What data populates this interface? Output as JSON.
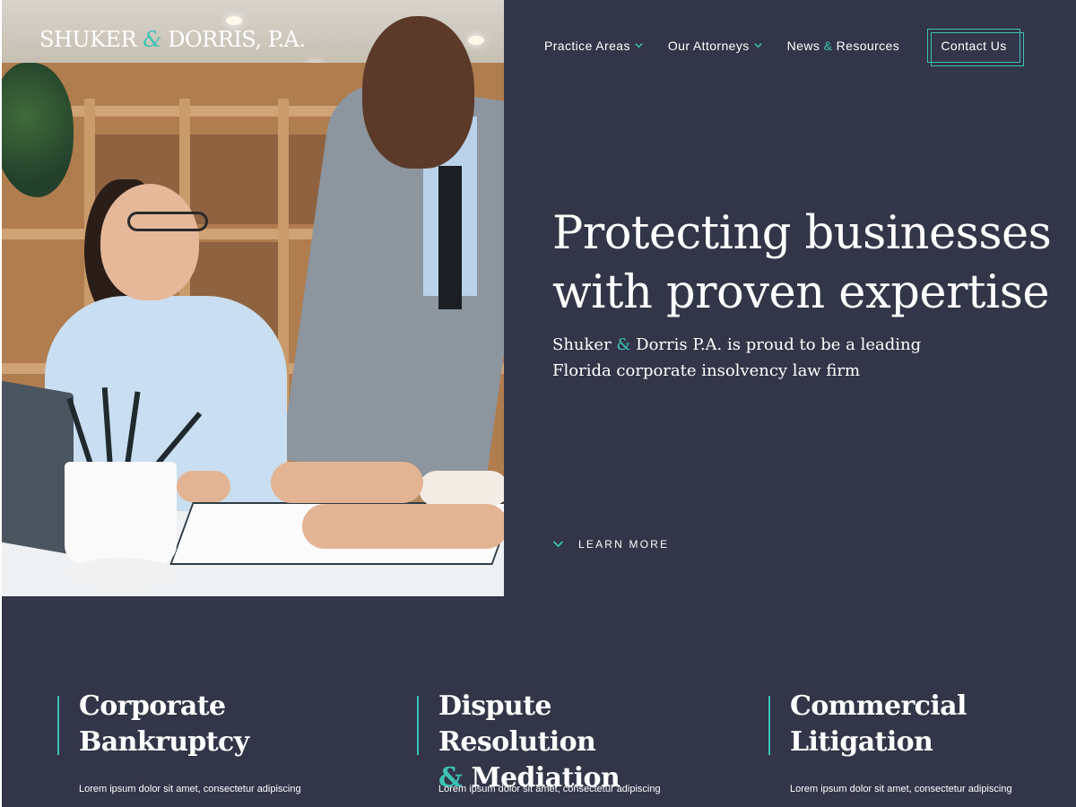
{
  "brand": {
    "logo_part1": "SHUKER ",
    "logo_amp": "&",
    "logo_part2": " DORRIS, P.A.",
    "accent_color": "#3cc2b2",
    "background_color": "#333548"
  },
  "nav": {
    "items": [
      {
        "label": "Practice Areas",
        "has_dropdown": true
      },
      {
        "label": "Our Attorneys",
        "has_dropdown": true
      },
      {
        "label_a": "News ",
        "label_amp": "&",
        "label_b": " Resources",
        "has_dropdown": false
      }
    ],
    "contact_label": "Contact Us"
  },
  "hero": {
    "headline_line1": "Protecting businesses",
    "headline_line2": "with proven expertise",
    "subhead_a": "Shuker ",
    "subhead_amp": "&",
    "subhead_b": " Dorris P.A. is proud to be a leading",
    "subhead_line2": "Florida corporate insolvency law firm",
    "learn_more": "LEARN MORE",
    "photo_icon": "office-meeting-photo"
  },
  "services": [
    {
      "title_line1": "Corporate",
      "title_line2": "Bankruptcy",
      "description": "Lorem ipsum dolor sit amet, consectetur adipiscing"
    },
    {
      "title_line1": "Dispute Resolution",
      "title_amp": "&",
      "title_line2": " Mediation",
      "description": "Lorem ipsum dolor sit amet, consectetur adipiscing"
    },
    {
      "title_line1": "Commercial",
      "title_line2": "Litigation",
      "description": "Lorem ipsum dolor sit amet, consectetur adipiscing"
    }
  ]
}
